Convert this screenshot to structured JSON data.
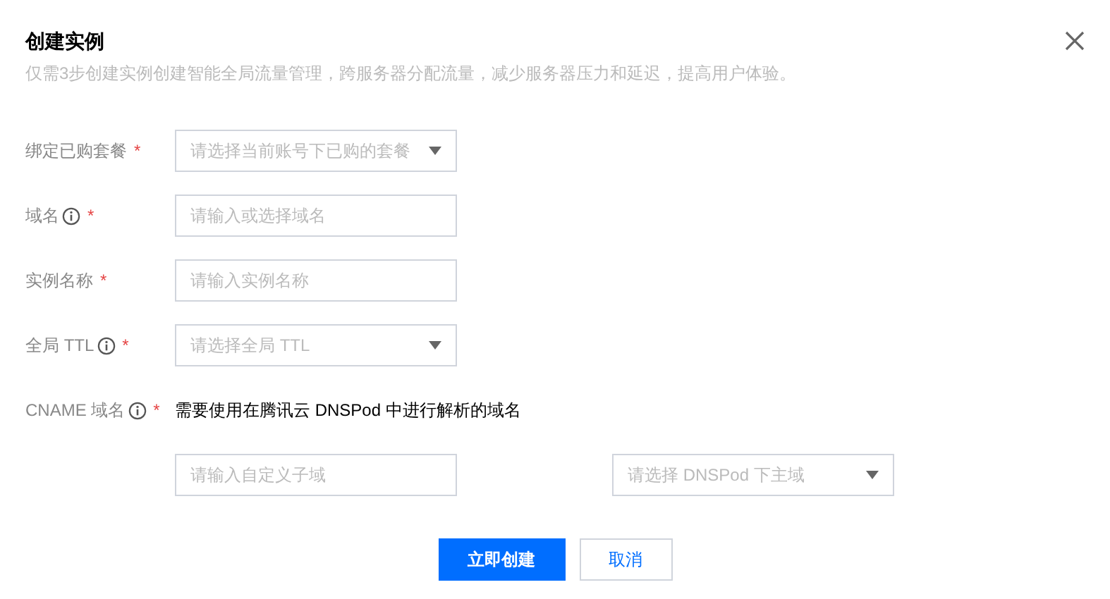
{
  "dialog": {
    "title": "创建实例",
    "description": "仅需3步创建实例创建智能全局流量管理，跨服务器分配流量，减少服务器压力和延迟，提高用户体验。"
  },
  "fields": [
    {
      "label": "绑定已购套餐",
      "info": false,
      "mark": "*",
      "kind": "select",
      "placeholder": "请选择当前账号下已购的套餐"
    },
    {
      "label": "域名",
      "info": true,
      "mark": "*",
      "kind": "input",
      "placeholder": "请输入或选择域名"
    },
    {
      "label": "实例名称",
      "info": false,
      "mark": "*",
      "kind": "input",
      "placeholder": "请输入实例名称"
    },
    {
      "label": "全局 TTL",
      "info": true,
      "mark": "*",
      "kind": "select",
      "placeholder": "请选择全局 TTL"
    }
  ],
  "cname": {
    "label": "CNAME 域名",
    "info": true,
    "mark": "*",
    "note": "需要使用在腾讯云 DNSPod 中进行解析的域名",
    "controls": [
      {
        "kind": "input",
        "placeholder": "请输入自定义子域"
      },
      {
        "kind": "select",
        "placeholder": "请选择 DNSPod 下主域"
      }
    ]
  },
  "buttons": [
    {
      "label": "立即创建",
      "kind": "primary"
    },
    {
      "label": "取消",
      "kind": "default"
    }
  ]
}
